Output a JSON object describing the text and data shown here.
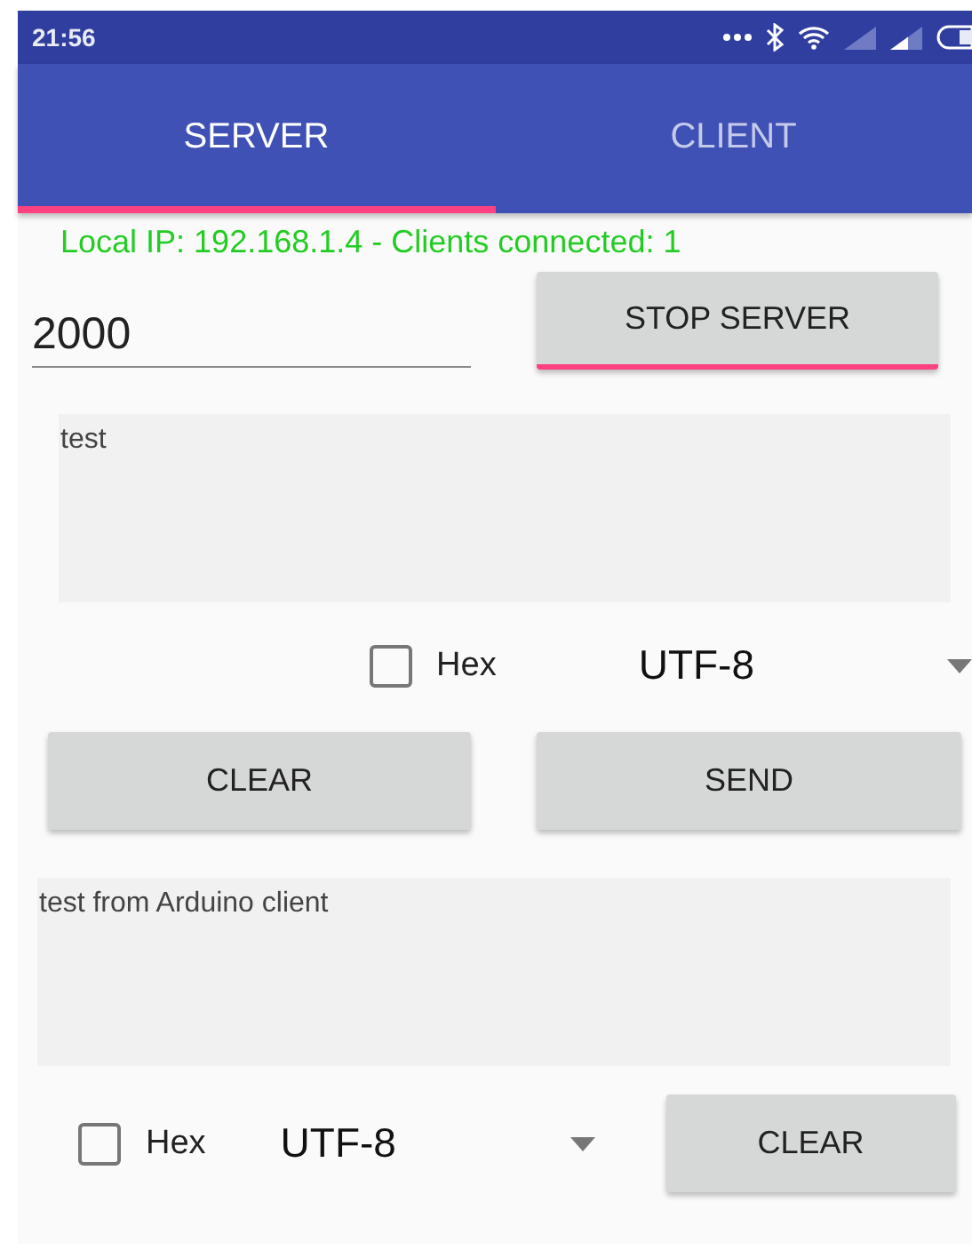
{
  "status_bar": {
    "time": "21:56"
  },
  "tabs": [
    {
      "label": "SERVER",
      "selected": true
    },
    {
      "label": "CLIENT",
      "selected": false
    }
  ],
  "server": {
    "status_text": "Local IP: 192.168.1.4 - Clients connected: 1",
    "port": {
      "value": "2000"
    },
    "server_button": {
      "label": "STOP SERVER",
      "focused": true
    },
    "send_area": {
      "value": "test"
    },
    "send_options": {
      "hex": {
        "label": "Hex",
        "checked": false
      },
      "encoding": "UTF-8"
    },
    "send_buttons": [
      {
        "label": "CLEAR",
        "focused": false
      },
      {
        "label": "SEND",
        "focused": false
      }
    ],
    "receive_area": {
      "value": "test from Arduino client"
    },
    "receive_options": {
      "hex": {
        "label": "Hex",
        "checked": false
      },
      "encoding": "UTF-8"
    },
    "receive_button": {
      "label": "CLEAR",
      "focused": false
    }
  }
}
